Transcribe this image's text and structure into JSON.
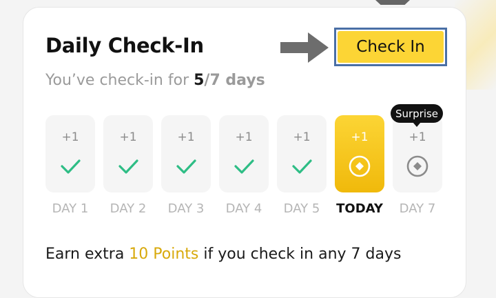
{
  "header": {
    "title": "Daily Check-In",
    "checkin_button": "Check In"
  },
  "progress": {
    "prefix": "You’ve check-in for ",
    "current": "5",
    "total": "/7 days"
  },
  "days": [
    {
      "points": "+1",
      "label": "DAY 1",
      "status": "checked",
      "icon": "check-icon"
    },
    {
      "points": "+1",
      "label": "DAY 2",
      "status": "checked",
      "icon": "check-icon"
    },
    {
      "points": "+1",
      "label": "DAY 3",
      "status": "checked",
      "icon": "check-icon"
    },
    {
      "points": "+1",
      "label": "DAY 4",
      "status": "checked",
      "icon": "check-icon"
    },
    {
      "points": "+1",
      "label": "DAY 5",
      "status": "checked",
      "icon": "check-icon"
    },
    {
      "points": "+1",
      "label": "TODAY",
      "status": "today",
      "icon": "coin-icon"
    },
    {
      "points": "+1",
      "label": "DAY 7",
      "status": "upcoming",
      "icon": "coin-icon"
    }
  ],
  "tooltip": "Surprise",
  "footer": {
    "prefix": "Earn extra ",
    "highlight": "10 Points",
    "suffix": " if you check in any 7 days"
  },
  "colors": {
    "accent": "#fcd535",
    "accent_dark": "#f0b90b",
    "check": "#2ebd85",
    "highlight_text": "#d8a90b",
    "button_outline": "#4a6fa5"
  }
}
